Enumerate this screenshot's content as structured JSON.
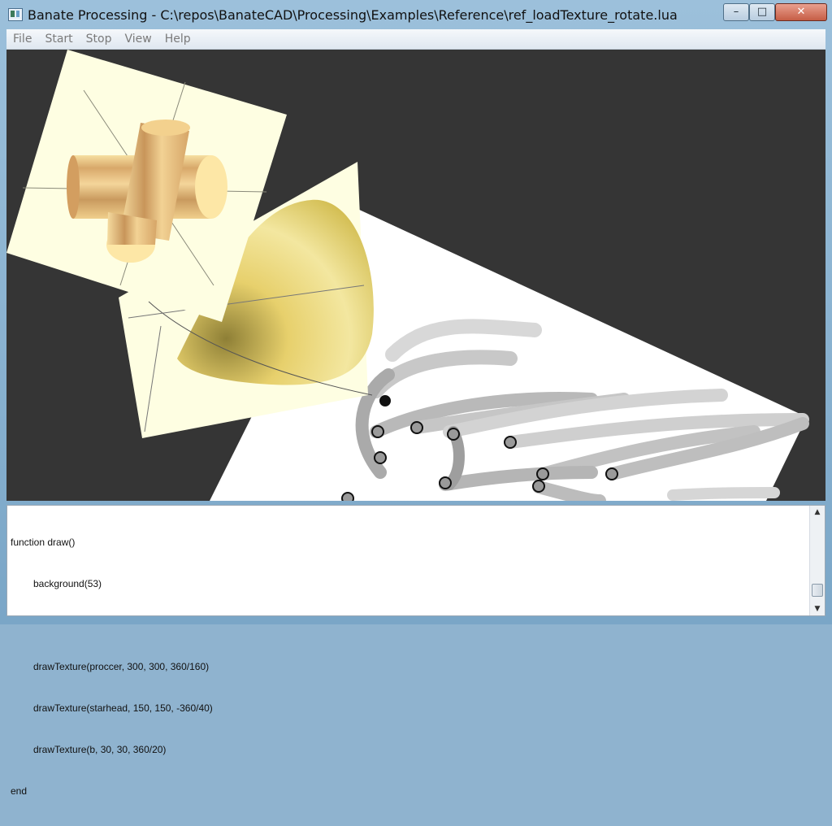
{
  "window": {
    "title": "Banate Processing - C:\\repos\\BanateCAD\\Processing\\Examples\\Reference\\ref_loadTexture_rotate.lua",
    "controls": {
      "minimize": "–",
      "maximize": "□",
      "close": "✕"
    }
  },
  "menu": {
    "file": "File",
    "start": "Start",
    "stop": "Stop",
    "view": "View",
    "help": "Help"
  },
  "canvas": {
    "background": "#353535"
  },
  "editor": {
    "lines": [
      "function draw()",
      "background(53)",
      "",
      "drawTexture(proccer, 300, 300, 360/160)",
      "drawTexture(starhead, 150, 150, -360/40)",
      "drawTexture(b, 30, 30, 360/20)",
      "end"
    ],
    "indented": [
      false,
      true,
      false,
      true,
      true,
      true,
      false
    ]
  },
  "scrollbar": {
    "up": "▲",
    "down": "▼"
  }
}
